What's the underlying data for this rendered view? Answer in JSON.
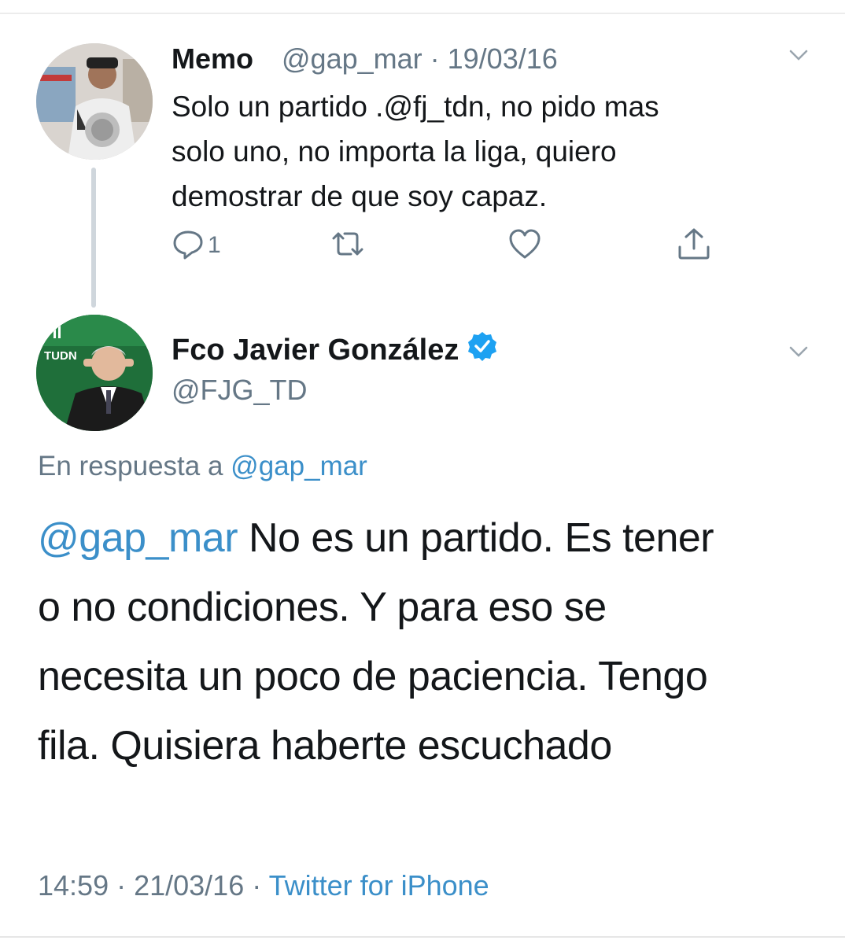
{
  "tweet1": {
    "name": "Memo",
    "handle": "@gap_mar",
    "date": "19/03/16",
    "text_line1": "Solo un partido .@fj_tdn, no pido mas",
    "text_line2": "solo uno, no importa la liga, quiero",
    "text_line3": "demostrar de que soy capaz.",
    "reply_count": "1",
    "icons": [
      "reply-icon",
      "retweet-icon",
      "like-icon",
      "share-icon",
      "chevron-down-icon"
    ]
  },
  "tweet2": {
    "name": "Fco Javier González",
    "handle": "@FJG_TD",
    "verified": true,
    "reply_to_label": "En respuesta a",
    "reply_to_handle": "@gap_mar",
    "mention": "@gap_mar",
    "text_line1": " No es un partido. Es tener",
    "text_line2": "o no condiciones. Y para eso se",
    "text_line3": "necesita un poco de paciencia. Tengo",
    "text_line4": "fila. Quisiera haberte escuchado",
    "time": "14:59",
    "date": "21/03/16",
    "source": "Twitter for iPhone",
    "avatar_badge": "TUDN"
  },
  "colors": {
    "link": "#3b8fc9",
    "secondary": "#657786",
    "verified": "#1da1f2",
    "tudn_green": "#1f6f3a"
  }
}
